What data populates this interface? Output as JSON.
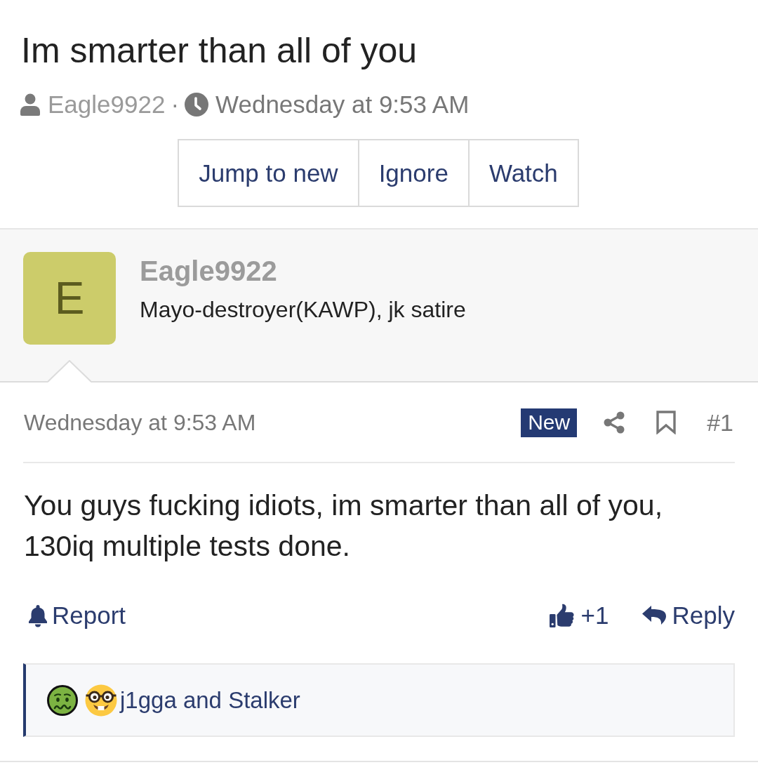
{
  "thread": {
    "title": "Im smarter than all of you",
    "author": "Eagle9922",
    "separator": "·",
    "date": "Wednesday at 9:53 AM"
  },
  "thread_actions": [
    {
      "label": "Jump to new"
    },
    {
      "label": "Ignore"
    },
    {
      "label": "Watch"
    }
  ],
  "post": {
    "user": {
      "avatar_letter": "E",
      "name": "Eagle9922",
      "user_title": "Mayo-destroyer(KAWP), jk satire"
    },
    "date": "Wednesday at 9:53 AM",
    "new_badge": "New",
    "number": "#1",
    "body": "You guys fucking idiots, im smarter than all of you, 130iq multiple tests done.",
    "actions": {
      "report": "Report",
      "like_count": "+1",
      "reply": "Reply"
    },
    "reactions": {
      "emojis": [
        {
          "kind": "sick"
        },
        {
          "kind": "nerd"
        }
      ],
      "users": "j1gga and Stalker"
    }
  }
}
